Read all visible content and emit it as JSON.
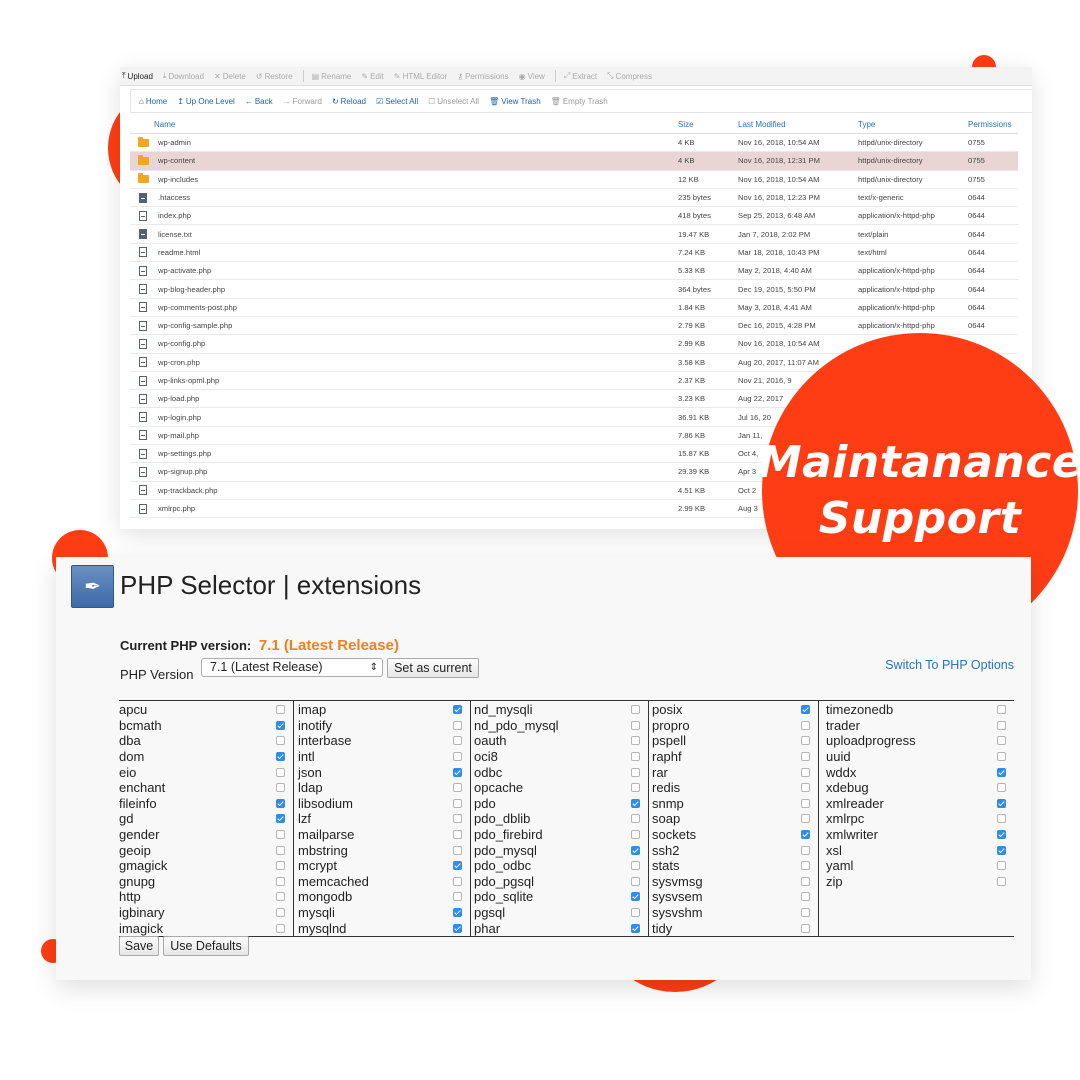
{
  "colors": {
    "accent": "#ff3d14",
    "link": "#2a71b5",
    "version_highlight": "#f0801a",
    "checkbox_on": "#2d8de8",
    "selected_row": "#ead5d5"
  },
  "file_manager": {
    "toolbar": [
      {
        "label": "Upload",
        "icon": "upload-icon",
        "glyph": "⤒",
        "active": true
      },
      {
        "label": "Download",
        "icon": "download-icon",
        "glyph": "⤓",
        "active": false
      },
      {
        "label": "Delete",
        "icon": "close-icon",
        "glyph": "✕",
        "active": false
      },
      {
        "label": "Restore",
        "icon": "undo-icon",
        "glyph": "↺",
        "active": false
      },
      {
        "label": "Rename",
        "icon": "file-icon",
        "glyph": "▤",
        "active": false
      },
      {
        "label": "Edit",
        "icon": "pencil-icon",
        "glyph": "✎",
        "active": false
      },
      {
        "label": "HTML Editor",
        "icon": "html-editor-icon",
        "glyph": "✎",
        "active": false
      },
      {
        "label": "Permissions",
        "icon": "key-icon",
        "glyph": "⚷",
        "active": false
      },
      {
        "label": "View",
        "icon": "eye-icon",
        "glyph": "◉",
        "active": false
      },
      {
        "label": "Extract",
        "icon": "extract-icon",
        "glyph": "⤢",
        "active": false
      },
      {
        "label": "Compress",
        "icon": "compress-icon",
        "glyph": "⤡",
        "active": false
      }
    ],
    "nav": [
      {
        "label": "Home",
        "icon": "home-icon",
        "glyph": "⌂",
        "disabled": false
      },
      {
        "label": "Up One Level",
        "icon": "level-up-icon",
        "glyph": "↥",
        "disabled": false
      },
      {
        "label": "Back",
        "icon": "arrow-left-icon",
        "glyph": "←",
        "disabled": false
      },
      {
        "label": "Forward",
        "icon": "arrow-right-icon",
        "glyph": "→",
        "disabled": true
      },
      {
        "label": "Reload",
        "icon": "reload-icon",
        "glyph": "↻",
        "disabled": false
      },
      {
        "label": "Select All",
        "icon": "check-square-icon",
        "glyph": "☑",
        "disabled": false
      },
      {
        "label": "Unselect All",
        "icon": "square-icon",
        "glyph": "☐",
        "disabled": true
      },
      {
        "label": "View Trash",
        "icon": "trash-icon",
        "glyph": "🗑",
        "disabled": false
      },
      {
        "label": "Empty Trash",
        "icon": "trash-empty-icon",
        "glyph": "🗑",
        "disabled": true
      }
    ],
    "columns": {
      "name": "Name",
      "size": "Size",
      "modified": "Last Modified",
      "type": "Type",
      "permissions": "Permissions"
    },
    "rows": [
      {
        "icon": "folder-icon",
        "name": "wp-admin",
        "size": "4 KB",
        "modified": "Nov 16, 2018, 10:54 AM",
        "type": "httpd/unix-directory",
        "perm": "0755",
        "selected": false
      },
      {
        "icon": "folder-icon",
        "name": "wp-content",
        "size": "4 KB",
        "modified": "Nov 16, 2018, 12:31 PM",
        "type": "httpd/unix-directory",
        "perm": "0755",
        "selected": true
      },
      {
        "icon": "folder-icon",
        "name": "wp-includes",
        "size": "12 KB",
        "modified": "Nov 16, 2018, 10:54 AM",
        "type": "httpd/unix-directory",
        "perm": "0755",
        "selected": false
      },
      {
        "icon": "text-file-icon",
        "name": ".htaccess",
        "size": "235 bytes",
        "modified": "Nov 16, 2018, 12:23 PM",
        "type": "text/x-generic",
        "perm": "0644",
        "selected": false
      },
      {
        "icon": "php-file-icon",
        "name": "index.php",
        "size": "418 bytes",
        "modified": "Sep 25, 2013, 6:48 AM",
        "type": "application/x-httpd-php",
        "perm": "0644",
        "selected": false
      },
      {
        "icon": "text-file-icon",
        "name": "license.txt",
        "size": "19.47 KB",
        "modified": "Jan 7, 2018, 2:02 PM",
        "type": "text/plain",
        "perm": "0644",
        "selected": false
      },
      {
        "icon": "php-file-icon",
        "name": "readme.html",
        "size": "7.24 KB",
        "modified": "Mar 18, 2018, 10:43 PM",
        "type": "text/html",
        "perm": "0644",
        "selected": false
      },
      {
        "icon": "php-file-icon",
        "name": "wp-activate.php",
        "size": "5.33 KB",
        "modified": "May 2, 2018, 4:40 AM",
        "type": "application/x-httpd-php",
        "perm": "0644",
        "selected": false
      },
      {
        "icon": "php-file-icon",
        "name": "wp-blog-header.php",
        "size": "364 bytes",
        "modified": "Dec 19, 2015, 5:50 PM",
        "type": "application/x-httpd-php",
        "perm": "0644",
        "selected": false
      },
      {
        "icon": "php-file-icon",
        "name": "wp-comments-post.php",
        "size": "1.84 KB",
        "modified": "May 3, 2018, 4:41 AM",
        "type": "application/x-httpd-php",
        "perm": "0644",
        "selected": false
      },
      {
        "icon": "php-file-icon",
        "name": "wp-config-sample.php",
        "size": "2.79 KB",
        "modified": "Dec 16, 2015, 4:28 PM",
        "type": "application/x-httpd-php",
        "perm": "0644",
        "selected": false
      },
      {
        "icon": "php-file-icon",
        "name": "wp-config.php",
        "size": "2.99 KB",
        "modified": "Nov 16, 2018, 10:54 AM",
        "type": "",
        "perm": "",
        "selected": false
      },
      {
        "icon": "php-file-icon",
        "name": "wp-cron.php",
        "size": "3.58 KB",
        "modified": "Aug 20, 2017, 11:07 AM",
        "type": "",
        "perm": "",
        "selected": false
      },
      {
        "icon": "php-file-icon",
        "name": "wp-links-opml.php",
        "size": "2.37 KB",
        "modified": "Nov 21, 2016, 9",
        "type": "",
        "perm": "",
        "selected": false
      },
      {
        "icon": "php-file-icon",
        "name": "wp-load.php",
        "size": "3.23 KB",
        "modified": "Aug 22, 2017",
        "type": "",
        "perm": "",
        "selected": false
      },
      {
        "icon": "php-file-icon",
        "name": "wp-login.php",
        "size": "36.91 KB",
        "modified": "Jul 16, 20",
        "type": "",
        "perm": "",
        "selected": false
      },
      {
        "icon": "php-file-icon",
        "name": "wp-mail.php",
        "size": "7.86 KB",
        "modified": "Jan 11,",
        "type": "",
        "perm": "",
        "selected": false
      },
      {
        "icon": "php-file-icon",
        "name": "wp-settings.php",
        "size": "15.87 KB",
        "modified": "Oct 4,",
        "type": "",
        "perm": "",
        "selected": false
      },
      {
        "icon": "php-file-icon",
        "name": "wp-signup.php",
        "size": "29.39 KB",
        "modified": "Apr 3",
        "type": "",
        "perm": "",
        "selected": false
      },
      {
        "icon": "php-file-icon",
        "name": "wp-trackback.php",
        "size": "4.51 KB",
        "modified": "Oct 2",
        "type": "",
        "perm": "",
        "selected": false
      },
      {
        "icon": "php-file-icon",
        "name": "xmlrpc.php",
        "size": "2.99 KB",
        "modified": "Aug 3",
        "type": "",
        "perm": "",
        "selected": false
      }
    ]
  },
  "badge": {
    "line1": "Maintanance",
    "line2": "Support"
  },
  "php_selector": {
    "logo_icon": "php-selector-icon",
    "title": "PHP Selector | extensions",
    "current_label": "Current PHP version:",
    "current_value": "7.1 (Latest Release)",
    "version_label": "PHP Version",
    "version_selected": "7.1 (Latest Release)",
    "set_current_label": "Set as current",
    "switch_label": "Switch To PHP Options",
    "save_label": "Save",
    "defaults_label": "Use Defaults",
    "columns": [
      [
        [
          "apcu",
          false
        ],
        [
          "bcmath",
          true
        ],
        [
          "dba",
          false
        ],
        [
          "dom",
          true
        ],
        [
          "eio",
          false
        ],
        [
          "enchant",
          false
        ],
        [
          "fileinfo",
          true
        ],
        [
          "gd",
          true
        ],
        [
          "gender",
          false
        ],
        [
          "geoip",
          false
        ],
        [
          "gmagick",
          false
        ],
        [
          "gnupg",
          false
        ],
        [
          "http",
          false
        ],
        [
          "igbinary",
          false
        ],
        [
          "imagick",
          false
        ]
      ],
      [
        [
          "imap",
          true
        ],
        [
          "inotify",
          false
        ],
        [
          "interbase",
          false
        ],
        [
          "intl",
          false
        ],
        [
          "json",
          true
        ],
        [
          "ldap",
          false
        ],
        [
          "libsodium",
          false
        ],
        [
          "lzf",
          false
        ],
        [
          "mailparse",
          false
        ],
        [
          "mbstring",
          false
        ],
        [
          "mcrypt",
          true
        ],
        [
          "memcached",
          false
        ],
        [
          "mongodb",
          false
        ],
        [
          "mysqli",
          true
        ],
        [
          "mysqlnd",
          true
        ]
      ],
      [
        [
          "nd_mysqli",
          false
        ],
        [
          "nd_pdo_mysql",
          false
        ],
        [
          "oauth",
          false
        ],
        [
          "oci8",
          false
        ],
        [
          "odbc",
          false
        ],
        [
          "opcache",
          false
        ],
        [
          "pdo",
          true
        ],
        [
          "pdo_dblib",
          false
        ],
        [
          "pdo_firebird",
          false
        ],
        [
          "pdo_mysql",
          true
        ],
        [
          "pdo_odbc",
          false
        ],
        [
          "pdo_pgsql",
          false
        ],
        [
          "pdo_sqlite",
          true
        ],
        [
          "pgsql",
          false
        ],
        [
          "phar",
          true
        ]
      ],
      [
        [
          "posix",
          true
        ],
        [
          "propro",
          false
        ],
        [
          "pspell",
          false
        ],
        [
          "raphf",
          false
        ],
        [
          "rar",
          false
        ],
        [
          "redis",
          false
        ],
        [
          "snmp",
          false
        ],
        [
          "soap",
          false
        ],
        [
          "sockets",
          true
        ],
        [
          "ssh2",
          false
        ],
        [
          "stats",
          false
        ],
        [
          "sysvmsg",
          false
        ],
        [
          "sysvsem",
          false
        ],
        [
          "sysvshm",
          false
        ],
        [
          "tidy",
          false
        ]
      ],
      [
        [
          "timezonedb",
          false
        ],
        [
          "trader",
          false
        ],
        [
          "uploadprogress",
          false
        ],
        [
          "uuid",
          false
        ],
        [
          "wddx",
          true
        ],
        [
          "xdebug",
          false
        ],
        [
          "xmlreader",
          true
        ],
        [
          "xmlrpc",
          false
        ],
        [
          "xmlwriter",
          true
        ],
        [
          "xsl",
          true
        ],
        [
          "yaml",
          false
        ],
        [
          "zip",
          false
        ]
      ]
    ]
  }
}
